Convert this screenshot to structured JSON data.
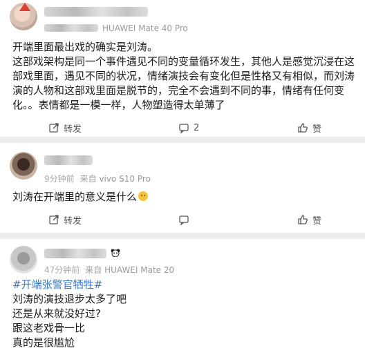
{
  "posts": [
    {
      "time": "",
      "source": "HUAWEI Mate 40 Pro",
      "paragraphs": [
        "开端里面最出戏的确实是刘涛。",
        "这部戏架构是同一个事件遇见不同的变量循环发生，其他人是感觉沉浸在这部戏里面，遇见不同的状况，情绪演技会有变化但是性格又有相似，而刘涛演的人物和这部戏里面是脱节的，完全不会遇到不同的事，情绪有任何变化。。表情都是一模一样，人物塑造得太单薄了"
      ],
      "actions": {
        "repost": "转发",
        "comment_count": "2",
        "like": "赞"
      }
    },
    {
      "time": "9分钟前",
      "source": "来自 vivo S10 Pro",
      "paragraphs": [
        "刘涛在开端里的意义是什么"
      ],
      "actions": {
        "repost": "转发",
        "comment_count": "",
        "like": "赞"
      }
    },
    {
      "time": "47分钟前",
      "source": "来自 HUAWEI Mate 20",
      "topic": "#开端张警官牺牲#",
      "paragraphs": [
        "刘涛的演技退步太多了吧",
        "还是从来就没好过?",
        "跟这老戏骨一比",
        "真的是很尴尬"
      ]
    }
  ],
  "icons": {
    "repost": "repost-icon",
    "comment": "comment-icon",
    "like": "like-icon",
    "emoji": "sweat-smile-emoji-icon",
    "panda": "panda-icon"
  },
  "colors": {
    "topic": "#3e78c8",
    "text": "#1b1b1b",
    "meta": "#9a9a9a",
    "background": "#ececec"
  }
}
